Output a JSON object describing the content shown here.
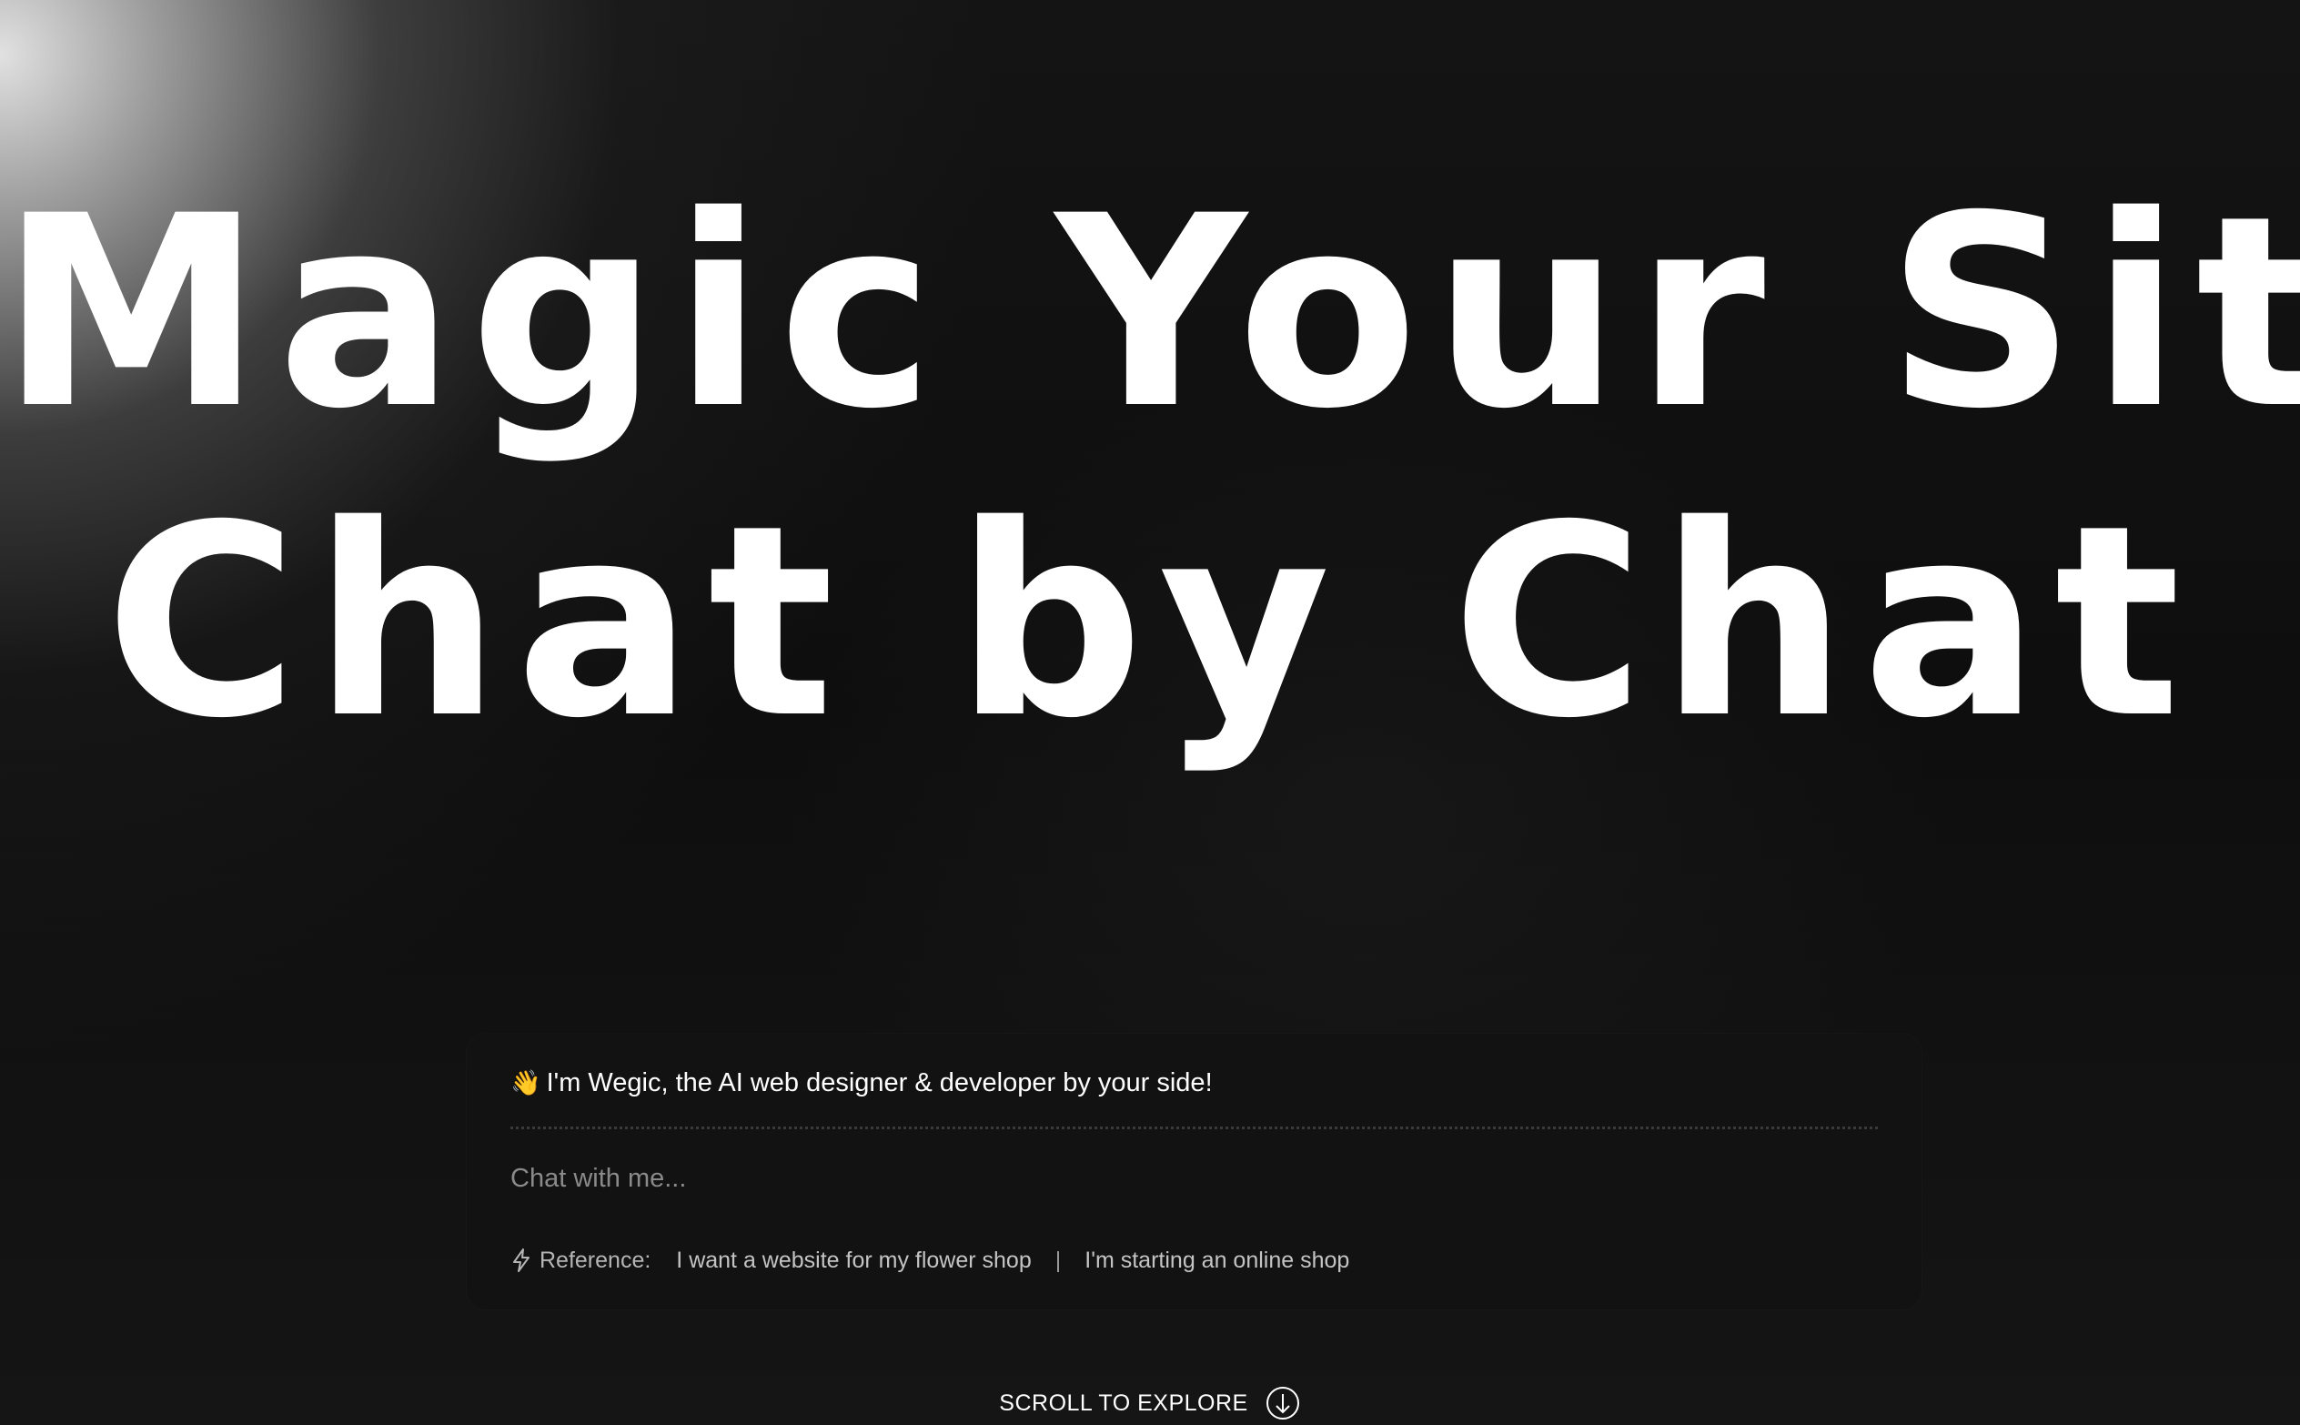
{
  "hero": {
    "headline_line1": "Magic Your Site",
    "headline_line2": "Chat by Chat"
  },
  "chat": {
    "greeting_icon": "👋",
    "greeting": "I'm Wegic, the AI web designer & developer by your side!",
    "input_placeholder": "Chat with me...",
    "reference_icon": "bolt-icon",
    "reference_label": "Reference:",
    "suggestions": [
      "I want a website for my flower shop",
      "I'm starting an online shop"
    ],
    "separator": "|"
  },
  "scroll": {
    "label": "SCROLL TO EXPLORE",
    "icon": "scroll-down-icon"
  },
  "colors": {
    "background": "#0d0d0d",
    "text": "#ffffff",
    "muted": "#b5b5b5"
  }
}
